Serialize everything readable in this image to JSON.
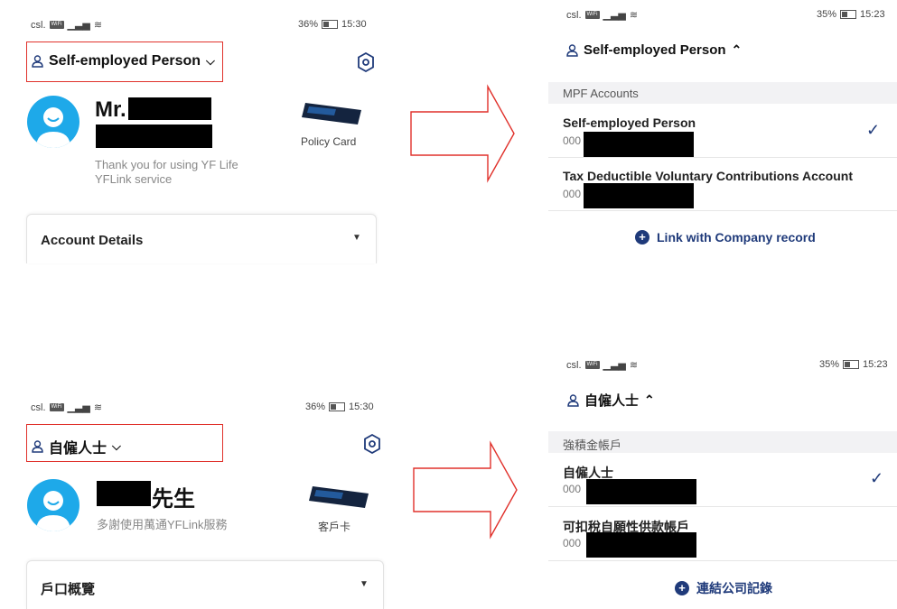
{
  "top": {
    "left_screen": {
      "carrier": "csl.",
      "wifi_tag": "WiFi",
      "battery": "36%",
      "time": "15:30",
      "account_type": "Self-employed Person",
      "greeting_name": "Mr.",
      "thanks": "Thank you for using YF Life YFLink service",
      "policy_card": "Policy Card",
      "account_details": "Account Details"
    },
    "right_screen": {
      "carrier": "csl.",
      "wifi_tag": "WiFi",
      "battery": "35%",
      "time": "15:23",
      "account_type": "Self-employed Person",
      "section_header": "MPF Accounts",
      "accounts": [
        {
          "name": "Self-employed Person",
          "number": "000"
        },
        {
          "name": "Tax Deductible Voluntary Contributions Account",
          "number": "000"
        }
      ],
      "link_label": "Link with Company record"
    }
  },
  "bottom": {
    "left_screen": {
      "carrier": "csl.",
      "wifi_tag": "WiFi",
      "battery": "36%",
      "time": "15:30",
      "account_type": "自僱人士",
      "greeting_suffix": "先生",
      "thanks": "多謝使用萬通YFLink服務",
      "policy_card": "客戶卡",
      "account_details": "戶口概覽"
    },
    "right_screen": {
      "carrier": "csl.",
      "wifi_tag": "WiFi",
      "battery": "35%",
      "time": "15:23",
      "account_type": "自僱人士",
      "section_header": "強積金帳戶",
      "accounts": [
        {
          "name": "自僱人士",
          "number": "000"
        },
        {
          "name": "可扣稅自願性供款帳戶",
          "number": "000"
        }
      ],
      "link_label": "連結公司記錄"
    }
  },
  "icons": {
    "person": "person-outline-icon",
    "settings": "hexagon-gear-icon",
    "dropdown": "chevron-down-icon",
    "collapse": "chevron-up-icon",
    "check": "checkmark-icon",
    "plus": "plus-circle-icon",
    "arrow": "right-arrow-outline-icon"
  },
  "colors": {
    "accent": "#1f3a7a",
    "avatar": "#1ea9e9",
    "highlight_box": "#e0312b"
  }
}
